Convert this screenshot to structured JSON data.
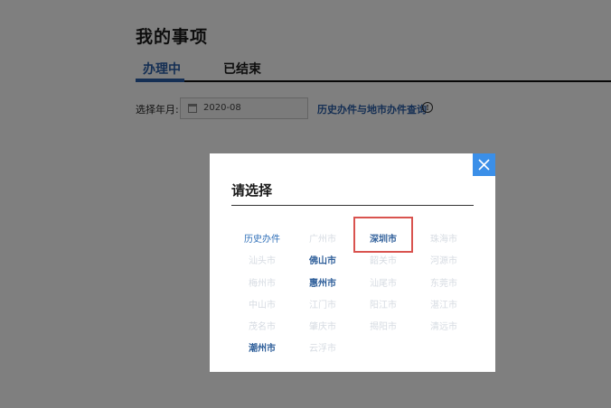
{
  "page": {
    "title": "我的事项",
    "tabs": [
      {
        "label": "办理中",
        "active": true
      },
      {
        "label": "已结束",
        "active": false
      }
    ],
    "filter": {
      "label": "选择年月:",
      "date_value": "2020-08",
      "history_link": "历史办件与地市办件查询",
      "info_icon_glyph": "!"
    }
  },
  "modal": {
    "title": "请选择",
    "close_icon": "close-icon",
    "options": [
      {
        "label": "历史办件",
        "state": "history"
      },
      {
        "label": "广州市",
        "state": "disabled"
      },
      {
        "label": "深圳市",
        "state": "enabled",
        "highlighted": true
      },
      {
        "label": "珠海市",
        "state": "disabled"
      },
      {
        "label": "汕头市",
        "state": "disabled"
      },
      {
        "label": "佛山市",
        "state": "enabled"
      },
      {
        "label": "韶关市",
        "state": "disabled"
      },
      {
        "label": "河源市",
        "state": "disabled"
      },
      {
        "label": "梅州市",
        "state": "disabled"
      },
      {
        "label": "惠州市",
        "state": "enabled"
      },
      {
        "label": "汕尾市",
        "state": "disabled"
      },
      {
        "label": "东莞市",
        "state": "disabled"
      },
      {
        "label": "中山市",
        "state": "disabled"
      },
      {
        "label": "江门市",
        "state": "disabled"
      },
      {
        "label": "阳江市",
        "state": "disabled"
      },
      {
        "label": "湛江市",
        "state": "disabled"
      },
      {
        "label": "茂名市",
        "state": "disabled"
      },
      {
        "label": "肇庆市",
        "state": "disabled"
      },
      {
        "label": "揭阳市",
        "state": "disabled"
      },
      {
        "label": "清远市",
        "state": "disabled"
      },
      {
        "label": "潮州市",
        "state": "enabled"
      },
      {
        "label": "云浮市",
        "state": "disabled"
      }
    ]
  },
  "colors": {
    "accent": "#2a5ea8",
    "close_button": "#3b8fe8",
    "highlight": "#d9534f",
    "disabled_text": "#d6dbe2"
  }
}
